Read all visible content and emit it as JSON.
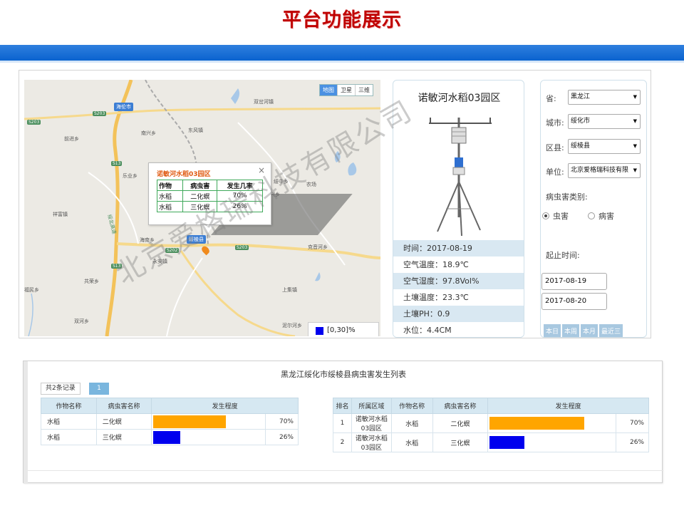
{
  "slide": {
    "title": "平台功能展示"
  },
  "map": {
    "type_buttons": [
      "地图",
      "卫星",
      "三维"
    ],
    "active_type": "地图",
    "city_tag": "海伦市",
    "place_labels": [
      "双岔河镇",
      "东风镇",
      "南兴乡",
      "前进乡",
      "乐业乡",
      "农场",
      "祥富镇",
      "海南乡",
      "永安镇",
      "共荣乡",
      "福民乡",
      "双河乡",
      "克音河乡",
      "上集镇",
      "泥尔河乡",
      "绥中乡",
      "东兴乡",
      "S203",
      "S13",
      "S13",
      "S202",
      "S203",
      "S203",
      "绥北高速"
    ],
    "county_tag": "绥棱县",
    "popup": {
      "title": "诺敏河水稻03园区",
      "close": "×",
      "headers": [
        "作物",
        "病虫害",
        "发生几率"
      ],
      "rows": [
        [
          "水稻",
          "二化螟",
          "70%"
        ],
        [
          "水稻",
          "三化螟",
          "26%"
        ]
      ]
    },
    "legend": {
      "color": "#0000ee",
      "text": "[0,30]%"
    }
  },
  "station": {
    "name": "诺敏河水稻03园区",
    "rows": [
      "时间：2017-08-19",
      "空气温度：18.9℃",
      "空气湿度：97.8Vol%",
      "土壤温度：23.3℃",
      "土壤PH：0.9",
      "水位：4.4CM"
    ]
  },
  "filter": {
    "province_label": "省:",
    "province_value": "黑龙江",
    "city_label": "城市:",
    "city_value": "绥化市",
    "district_label": "区县:",
    "district_value": "绥棱县",
    "unit_label": "单位:",
    "unit_value": "北京爱格瑞科技有限",
    "category_label": "病虫害类别:",
    "radio_insect": "虫害",
    "radio_disease": "病害",
    "start_label": "起止时间:",
    "start_date": "2017-08-19",
    "end_date": "2017-08-20",
    "quick_buttons": [
      "本日",
      "本周",
      "本月",
      "最近三"
    ]
  },
  "watermark": "北京爱格瑞科技有限公司",
  "list": {
    "title": "黑龙江绥化市绥棱县病虫害发生列表",
    "record_count": "共2条记录",
    "page": "1",
    "left_headers": [
      "作物名称",
      "病虫害名称",
      "发生程度"
    ],
    "left_rows": [
      {
        "crop": "水稻",
        "pest": "二化螟",
        "level": 0.7,
        "pct": "70%",
        "color": "#ffa500"
      },
      {
        "crop": "水稻",
        "pest": "三化螟",
        "level": 0.26,
        "pct": "26%",
        "color": "#0000ee"
      }
    ],
    "right_headers": [
      "排名",
      "所属区域",
      "作物名称",
      "病虫害名称",
      "发生程度"
    ],
    "right_rows": [
      {
        "rank": "1",
        "area_1": "诺敏河水稻",
        "area_2": "03园区",
        "crop": "水稻",
        "pest": "二化螟",
        "level": 0.7,
        "pct": "70%",
        "color": "#ffa500"
      },
      {
        "rank": "2",
        "area_1": "诺敏河水稻",
        "area_2": "03园区",
        "crop": "水稻",
        "pest": "三化螟",
        "level": 0.26,
        "pct": "26%",
        "color": "#0000ee"
      }
    ]
  }
}
